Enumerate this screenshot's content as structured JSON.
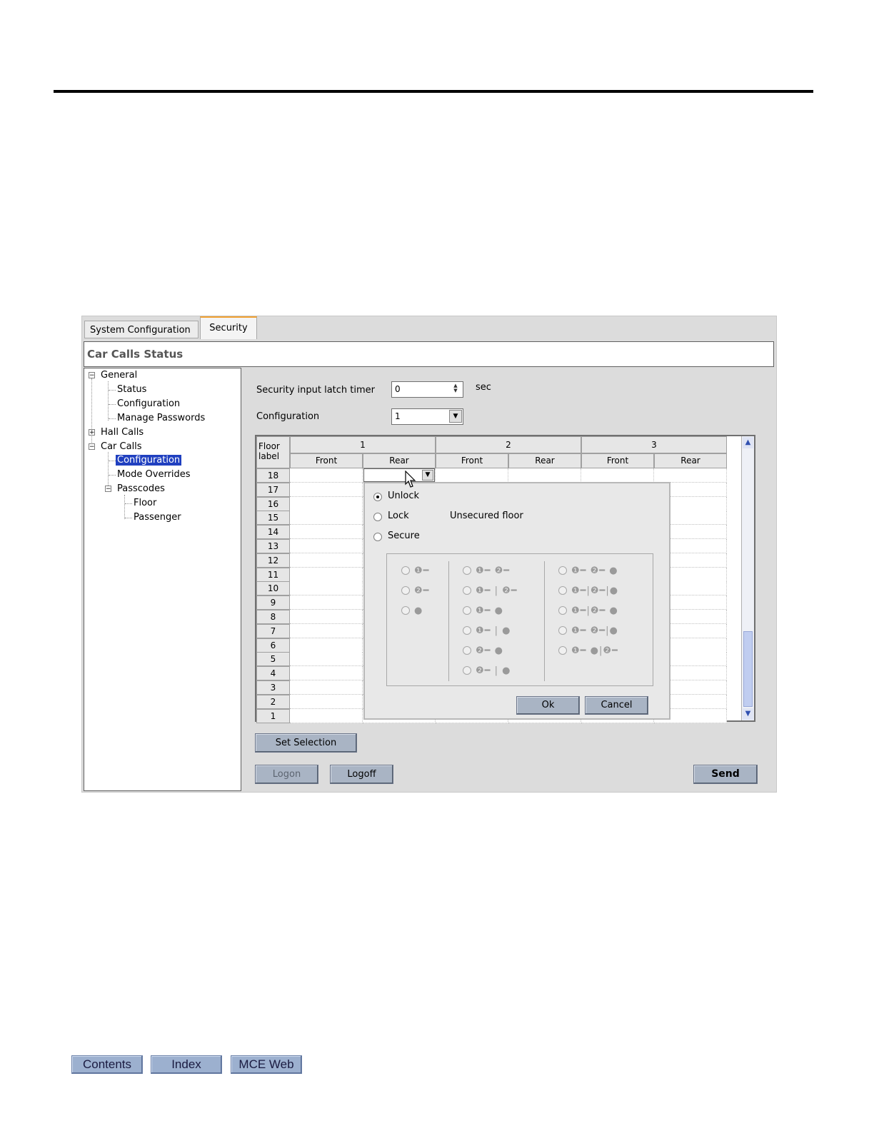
{
  "tabs": [
    {
      "label": "System Configuration",
      "active": false
    },
    {
      "label": "Security",
      "active": true
    }
  ],
  "panel_title": "Car Calls Status",
  "tree": {
    "general": "General",
    "status": "Status",
    "configuration": "Configuration",
    "manage_passwords": "Manage Passwords",
    "hall_calls": "Hall Calls",
    "car_calls": "Car Calls",
    "car_configuration": "Configuration",
    "mode_overrides": "Mode Overrides",
    "passcodes": "Passcodes",
    "floor": "Floor",
    "passenger": "Passenger"
  },
  "form": {
    "latch_timer_label": "Security input latch timer",
    "latch_timer_value": "0",
    "latch_timer_unit": "sec",
    "configuration_label": "Configuration",
    "configuration_value": "1"
  },
  "grid": {
    "floor_label_header": "Floor label",
    "cars": [
      "1",
      "2",
      "3"
    ],
    "door_headers": [
      "Front",
      "Rear",
      "Front",
      "Rear",
      "Front",
      "Rear"
    ],
    "floors": [
      "18",
      "17",
      "16",
      "15",
      "14",
      "13",
      "12",
      "11",
      "10",
      "9",
      "8",
      "7",
      "6",
      "5",
      "4",
      "3",
      "2",
      "1"
    ]
  },
  "popup": {
    "options": [
      {
        "label": "Unlock",
        "selected": true
      },
      {
        "label": "Lock",
        "selected": false
      },
      {
        "label": "Secure",
        "selected": false
      }
    ],
    "description": "Unsecured floor",
    "ok_label": "Ok",
    "cancel_label": "Cancel"
  },
  "buttons": {
    "set_selection": "Set Selection",
    "logon": "Logon",
    "logoff": "Logoff",
    "send": "Send"
  },
  "nav": {
    "contents": "Contents",
    "index": "Index",
    "mce_web": "MCE Web"
  },
  "colors": {
    "selection": "#2040c0",
    "button": "#a9b4c4",
    "active_tab_accent": "#f0a030",
    "nav_button": "#9cb0cf"
  }
}
